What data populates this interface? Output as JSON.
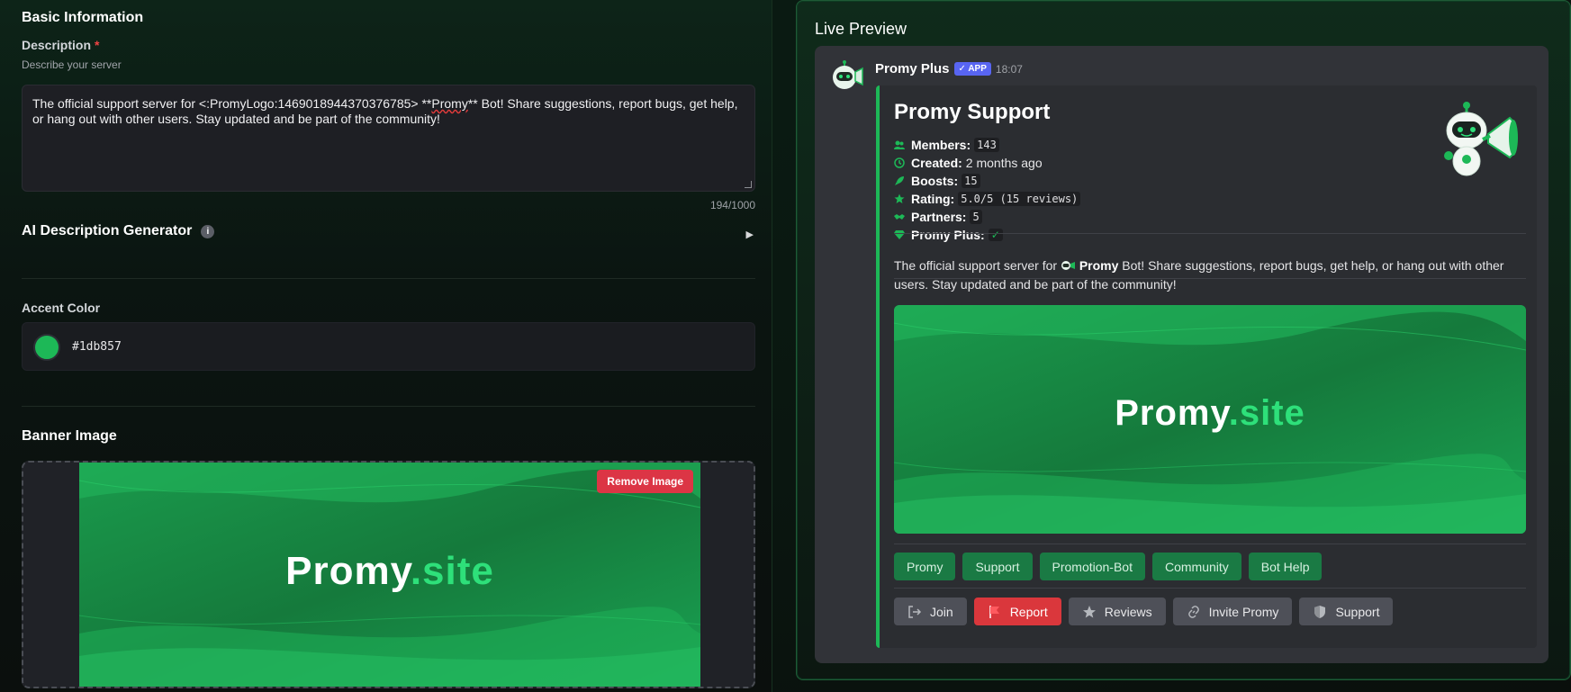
{
  "left": {
    "basic_info_heading": "Basic Information",
    "description_label": "Description",
    "required_mark": "*",
    "description_hint": "Describe your server",
    "description_value_1": "The official support server for <:PromyLogo:1469018944370376785> **",
    "description_value_promy": "Promy",
    "description_value_2": "** Bot! Share suggestions, report bugs, get help, or hang out with other users. Stay updated and be part of the community!",
    "char_counter": "194/1000",
    "ai_heading": "AI Description Generator",
    "ai_info_icon": "info-icon",
    "ai_toggle": "▶",
    "accent_label": "Accent Color",
    "accent_hex": "#1db857",
    "banner_label": "Banner Image",
    "remove_image_label": "Remove Image",
    "banner_text_main": "Promy",
    "banner_text_suffix": ".site"
  },
  "preview": {
    "title": "Live Preview",
    "author": "Promy Plus",
    "app_badge": "APP",
    "timestamp": "18:07",
    "embed_title": "Promy Support",
    "stats": {
      "members_label": "Members:",
      "members_value": "143",
      "created_label": "Created:",
      "created_value": "2 months ago",
      "boosts_label": "Boosts:",
      "boosts_value": "15",
      "rating_label": "Rating:",
      "rating_value": "5.0/5 (15 reviews)",
      "partners_label": "Partners:",
      "partners_value": "5",
      "plus_label": "Promy Plus:",
      "plus_value": "✓"
    },
    "desc_1": "The official support server for",
    "desc_promy": "Promy",
    "desc_2": "Bot! Share suggestions, report bugs, get help, or hang out with other users. Stay updated and be part of the community!",
    "banner_text_main": "Promy",
    "banner_text_suffix": ".site",
    "tags": [
      "Promy",
      "Support",
      "Promotion-Bot",
      "Community",
      "Bot Help"
    ],
    "actions": {
      "join": "Join",
      "report": "Report",
      "reviews": "Reviews",
      "invite": "Invite Promy",
      "support": "Support"
    }
  },
  "colors": {
    "accent": "#1db857",
    "danger": "#dc3545",
    "discord_bg": "#313338",
    "embed_bg": "#2b2d31",
    "app_badge": "#5865f2"
  }
}
